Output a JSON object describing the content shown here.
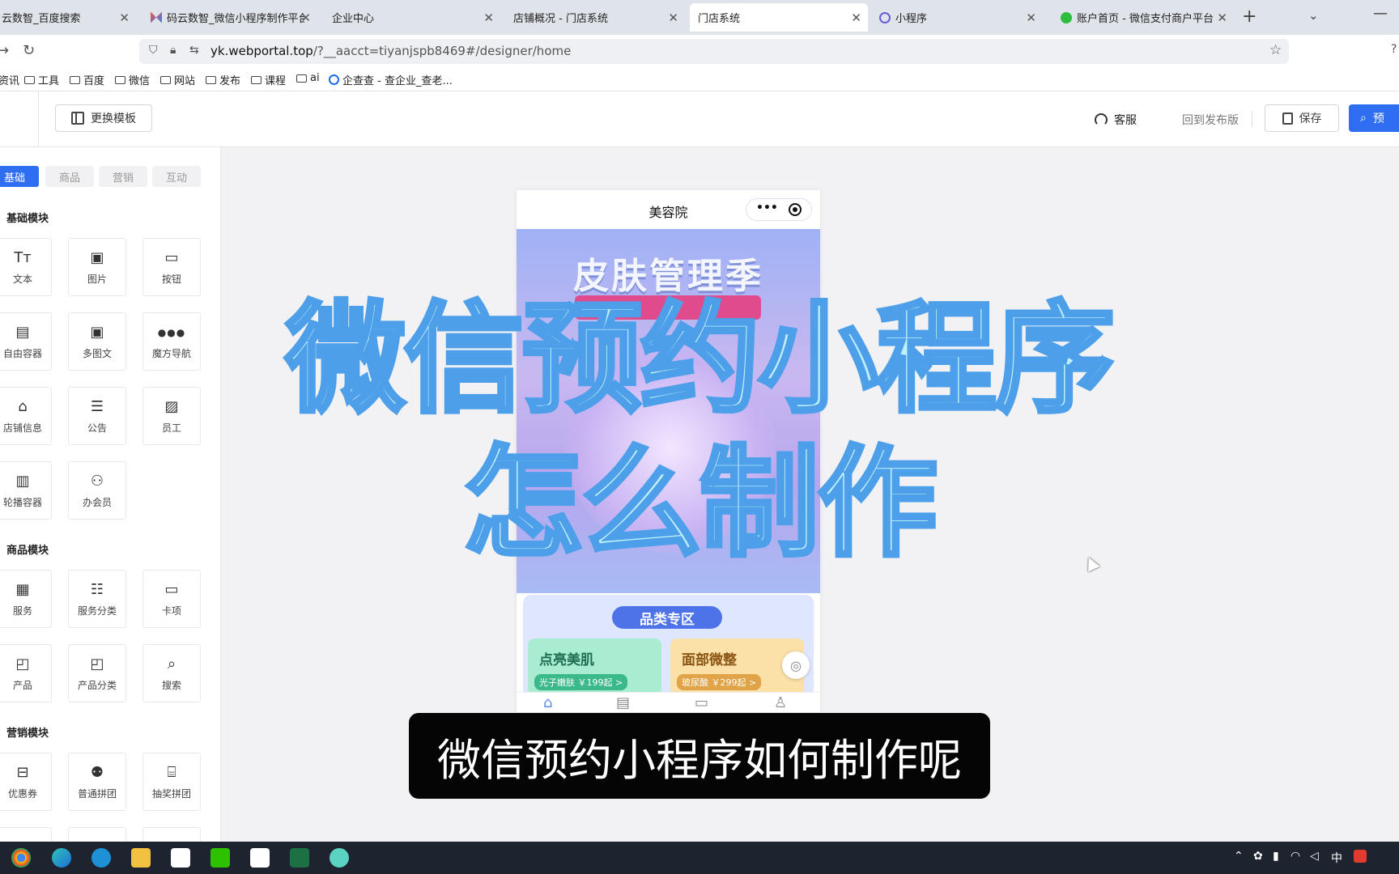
{
  "browser": {
    "tabs": [
      {
        "title": "云数智_百度搜索",
        "icon": "baidu-icon",
        "active": false
      },
      {
        "title": "码云数智_微信小程序制作平台_",
        "icon": "mayun-logo-icon",
        "active": false
      },
      {
        "title": "企业中心",
        "icon": "",
        "active": false
      },
      {
        "title": "店铺概况 - 门店系统",
        "icon": "",
        "active": false
      },
      {
        "title": "门店系统",
        "icon": "",
        "active": true
      },
      {
        "title": "小程序",
        "icon": "miniprogram-icon",
        "active": false
      },
      {
        "title": "账户首页 - 微信支付商户平台",
        "icon": "wechat-pay-icon",
        "active": false
      }
    ],
    "url_domain": "yk.webportal.top",
    "url_path": "/?__aacct=tiyanjspb8469#/designer/home",
    "bookmarks": [
      "资讯",
      "工具",
      "百度",
      "微信",
      "网站",
      "发布",
      "课程",
      "ai",
      "企查查 - 查企业_查老..."
    ]
  },
  "header": {
    "template_button": "更换模板",
    "customer_service": "客服",
    "back_to_published": "回到发布版",
    "save": "保存",
    "preview": "预"
  },
  "left_panel": {
    "category_tabs": [
      "基础",
      "商品",
      "营销",
      "互动"
    ],
    "sections": [
      {
        "title": "基础模块",
        "items": [
          {
            "label": "文本",
            "icon": "text-icon"
          },
          {
            "label": "图片",
            "icon": "image-icon"
          },
          {
            "label": "按钮",
            "icon": "button-icon"
          },
          {
            "label": "自由容器",
            "icon": "container-icon"
          },
          {
            "label": "多图文",
            "icon": "multi-image-icon"
          },
          {
            "label": "魔方导航",
            "icon": "grid-nav-icon"
          },
          {
            "label": "店铺信息",
            "icon": "store-icon"
          },
          {
            "label": "公告",
            "icon": "notice-icon"
          },
          {
            "label": "员工",
            "icon": "staff-icon"
          },
          {
            "label": "轮播容器",
            "icon": "carousel-icon"
          },
          {
            "label": "办会员",
            "icon": "member-icon"
          }
        ]
      },
      {
        "title": "商品模块",
        "items": [
          {
            "label": "服务",
            "icon": "service-icon"
          },
          {
            "label": "服务分类",
            "icon": "service-category-icon"
          },
          {
            "label": "卡项",
            "icon": "card-icon"
          },
          {
            "label": "产品",
            "icon": "product-icon"
          },
          {
            "label": "产品分类",
            "icon": "product-category-icon"
          },
          {
            "label": "搜索",
            "icon": "search-icon"
          }
        ]
      },
      {
        "title": "营销模块",
        "items": [
          {
            "label": "优惠券",
            "icon": "coupon-icon"
          },
          {
            "label": "普通拼团",
            "icon": "group-buy-icon"
          },
          {
            "label": "抽奖拼团",
            "icon": "lottery-icon"
          }
        ]
      }
    ]
  },
  "phone": {
    "title": "美容院",
    "banner_title": "皮肤管理季",
    "category_header": "品类专区",
    "cards": [
      {
        "title": "点亮美肌",
        "subtitle": "光子嫩肤 ￥199起 >"
      },
      {
        "title": "面部微整",
        "subtitle": "玻尿酸 ￥299起 >"
      }
    ],
    "tab_icons": [
      "home-icon",
      "booking-icon",
      "store-icon",
      "profile-icon"
    ]
  },
  "overlay": {
    "line1": "微信预约小程序",
    "line2": "怎么制作",
    "subtitle": "微信预约小程序如何制作呢"
  },
  "colors": {
    "accent": "#2f6ef0",
    "overlay_fill": "#bff0fb",
    "overlay_stroke": "#4c9fe8"
  }
}
